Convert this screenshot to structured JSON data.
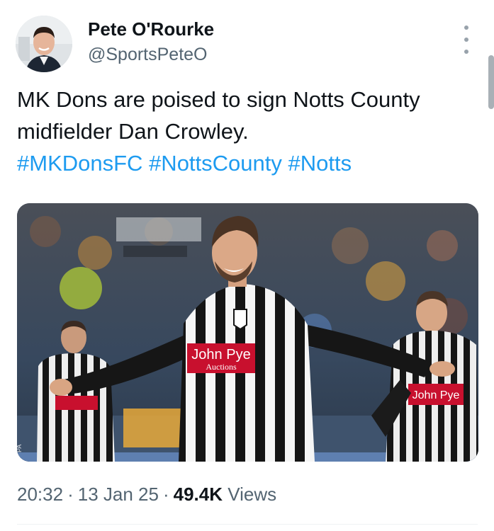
{
  "author": {
    "name": "Pete O'Rourke",
    "handle": "@SportsPeteO"
  },
  "tweet": {
    "text": "MK Dons are poised to sign Notts County midfielder Dan Crowley.",
    "hashtags": [
      "#MKDonsFC",
      "#NottsCounty",
      "#Notts"
    ]
  },
  "media": {
    "kind": "photo",
    "sponsor_main": "John Pye",
    "sponsor_sub": "Auctions",
    "shirt_colors": [
      "#111111",
      "#ffffff"
    ],
    "sponsor_color": "#c8102e"
  },
  "meta": {
    "time": "20:32",
    "date": "13 Jan 25",
    "views_count": "49.4K",
    "views_label": "Views"
  },
  "colors": {
    "link": "#1d9bf0",
    "secondary_text": "#536471",
    "primary_text": "#0f1419"
  }
}
